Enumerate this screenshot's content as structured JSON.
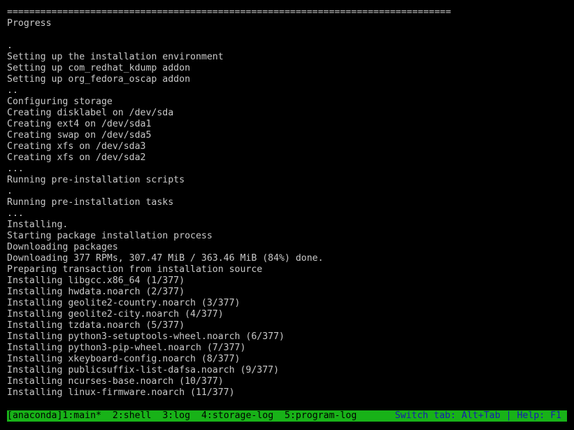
{
  "console": {
    "lines": [
      "================================================================================",
      "Progress",
      "",
      ".",
      "Setting up the installation environment",
      "Setting up com_redhat_kdump addon",
      "Setting up org_fedora_oscap addon",
      "..",
      "Configuring storage",
      "Creating disklabel on /dev/sda",
      "Creating ext4 on /dev/sda1",
      "Creating swap on /dev/sda5",
      "Creating xfs on /dev/sda3",
      "Creating xfs on /dev/sda2",
      "...",
      "Running pre-installation scripts",
      ".",
      "Running pre-installation tasks",
      "...",
      "Installing.",
      "Starting package installation process",
      "Downloading packages",
      "Downloading 377 RPMs, 307.47 MiB / 363.46 MiB (84%) done.",
      "Preparing transaction from installation source",
      "Installing libgcc.x86_64 (1/377)",
      "Installing hwdata.noarch (2/377)",
      "Installing geolite2-country.noarch (3/377)",
      "Installing geolite2-city.noarch (4/377)",
      "Installing tzdata.noarch (5/377)",
      "Installing python3-setuptools-wheel.noarch (6/377)",
      "Installing python3-pip-wheel.noarch (7/377)",
      "Installing xkeyboard-config.noarch (8/377)",
      "Installing publicsuffix-list-dafsa.noarch (9/377)",
      "Installing ncurses-base.noarch (10/377)",
      "Installing linux-firmware.noarch (11/377)"
    ]
  },
  "tmux": {
    "windows": [
      {
        "label": "[anaconda]1:main*"
      },
      {
        "label": "2:shell"
      },
      {
        "label": "3:log"
      },
      {
        "label": "4:storage-log"
      },
      {
        "label": "5:program-log"
      }
    ],
    "help": "Switch tab: Alt+Tab | Help: F1"
  },
  "colors": {
    "background": "#000000",
    "text": "#c8c8c8",
    "status_bar": "#18b218",
    "status_text": "#000000",
    "help_text": "#1818b2"
  }
}
